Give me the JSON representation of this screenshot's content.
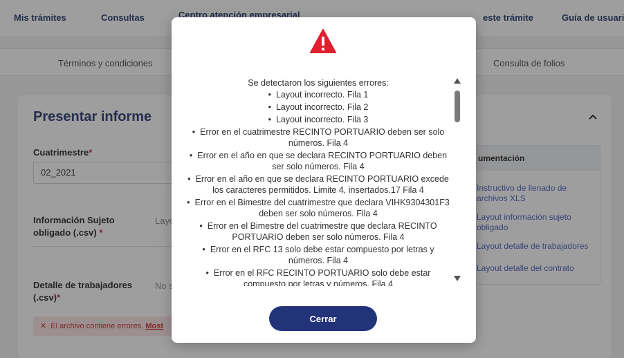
{
  "nav": {
    "items": [
      "Mis trámites",
      "Consultas",
      "Centro atención empresarial"
    ],
    "right_links": [
      "este trámite",
      "Guía de usuario"
    ]
  },
  "tabs": [
    "Términos y condiciones",
    "Consulta de folios"
  ],
  "form": {
    "title": "Presentar informe",
    "period_label": "Cuatrimestre",
    "period_value": "02_2021",
    "subject_label": "Información Sujeto obligado (.csv)",
    "subject_value": "Layout",
    "workers_label": "Detalle de trabajadores (.csv)",
    "workers_value": "No s",
    "error_text": "El archivo contiene errores.",
    "error_link": "Most"
  },
  "docs": {
    "header": "umentación",
    "links": [
      "Instructivo de llenado de archivos XLS",
      "Layout información sujeto obligado",
      "Layout detalle de trabajadores",
      "Layout detalle del contrato"
    ]
  },
  "modal": {
    "icon": "warning-triangle-icon",
    "intro": "Se detectaron los siguientes errores:",
    "errors": [
      "Layout incorrecto. Fila 1",
      "Layout incorrecto. Fila 2",
      "Layout incorrecto. Fila 3",
      "Error en el cuatrimestre RECINTO PORTUARIO deben ser solo números. Fila 4",
      "Error en el año en que se declara RECINTO PORTUARIO deben ser solo números. Fila 4",
      "Error en el año en que se declara RECINTO PORTUARIO excede los caracteres permitidos. Limite 4, insertados.17 Fila 4",
      "Error en el Bimestre del cuatrimestre que declara VIHK9304301F3 deben ser solo números. Fila 4",
      "Error en el Bimestre del cuatrimestre que declara RECINTO PORTUARIO deben ser solo números. Fila 4",
      "Error en el RFC 13 solo debe estar compuesto por letras y números. Fila 4",
      "Error en el RFC RECINTO PORTUARIO solo debe estar compuesto por letras y números. Fila 4"
    ],
    "close_label": "Cerrar"
  },
  "colors": {
    "primary": "#22337a",
    "danger": "#e0202e",
    "link": "#4a5dbb"
  }
}
